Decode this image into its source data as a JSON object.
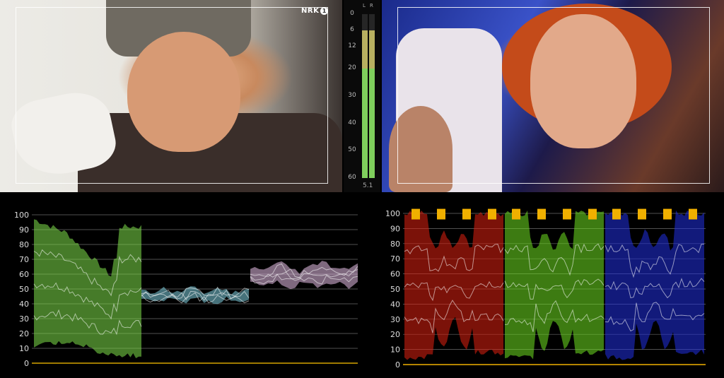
{
  "video_left": {
    "broadcaster_logo": "NRK",
    "channel_number": "1"
  },
  "audio_meter": {
    "channels": [
      "L",
      "R"
    ],
    "scale": [
      "0",
      "6",
      "12",
      "20",
      "30",
      "40",
      "50",
      "60"
    ],
    "format_label": "5.1",
    "level_left_db": 20,
    "level_right_db": 20,
    "colors": {
      "level": "#7fcf5c",
      "peak": "#b8b060"
    }
  },
  "waveform_left": {
    "title": "",
    "type": "luma_chroma_waveform",
    "y_ticks": [
      "0",
      "10",
      "20",
      "30",
      "40",
      "50",
      "60",
      "70",
      "80",
      "90",
      "100"
    ],
    "colors": {
      "luma": "#7fe04a",
      "cb": "#7fd0e0",
      "cr": "#e8c0e8",
      "baseline": "#d6a400",
      "grid": "#6a6a6a"
    }
  },
  "waveform_right": {
    "title": "",
    "type": "rgb_parade",
    "y_ticks": [
      "0",
      "10",
      "20",
      "30",
      "40",
      "50",
      "60",
      "70",
      "80",
      "90",
      "100"
    ],
    "colors": {
      "red": "#e02010",
      "green": "#6fe020",
      "blue": "#2030e0",
      "clip": "#f0b000",
      "grid": "#6a6a6a"
    }
  }
}
